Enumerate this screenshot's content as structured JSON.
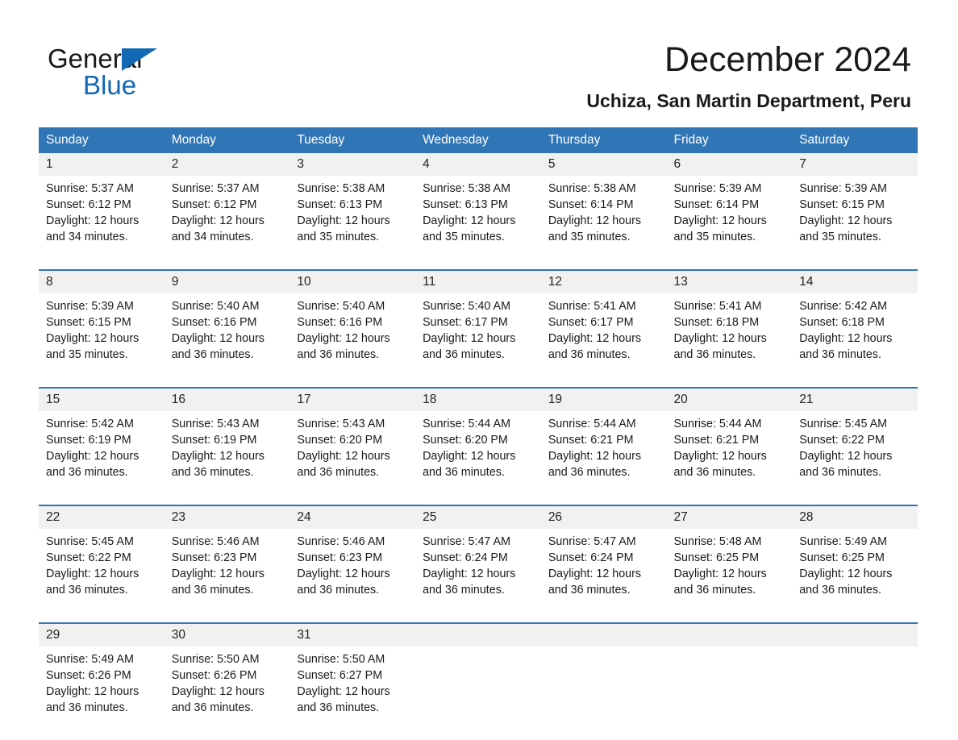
{
  "brand": {
    "name_part1": "General",
    "name_part2": "Blue",
    "logo_icon": "triangle-logo-icon"
  },
  "header": {
    "month_title": "December 2024",
    "location": "Uchiza, San Martin Department, Peru"
  },
  "theme": {
    "header_blue": "#3075b5",
    "daynum_band": "#f1f1f1",
    "logo_blue": "#1268b3",
    "text": "#1a1a1a"
  },
  "calendar": {
    "weekday_headers": [
      "Sunday",
      "Monday",
      "Tuesday",
      "Wednesday",
      "Thursday",
      "Friday",
      "Saturday"
    ],
    "weeks": [
      {
        "days": [
          {
            "date": "1",
            "sunrise": "Sunrise: 5:37 AM",
            "sunset": "Sunset: 6:12 PM",
            "daylight_line1": "Daylight: 12 hours",
            "daylight_line2": "and 34 minutes."
          },
          {
            "date": "2",
            "sunrise": "Sunrise: 5:37 AM",
            "sunset": "Sunset: 6:12 PM",
            "daylight_line1": "Daylight: 12 hours",
            "daylight_line2": "and 34 minutes."
          },
          {
            "date": "3",
            "sunrise": "Sunrise: 5:38 AM",
            "sunset": "Sunset: 6:13 PM",
            "daylight_line1": "Daylight: 12 hours",
            "daylight_line2": "and 35 minutes."
          },
          {
            "date": "4",
            "sunrise": "Sunrise: 5:38 AM",
            "sunset": "Sunset: 6:13 PM",
            "daylight_line1": "Daylight: 12 hours",
            "daylight_line2": "and 35 minutes."
          },
          {
            "date": "5",
            "sunrise": "Sunrise: 5:38 AM",
            "sunset": "Sunset: 6:14 PM",
            "daylight_line1": "Daylight: 12 hours",
            "daylight_line2": "and 35 minutes."
          },
          {
            "date": "6",
            "sunrise": "Sunrise: 5:39 AM",
            "sunset": "Sunset: 6:14 PM",
            "daylight_line1": "Daylight: 12 hours",
            "daylight_line2": "and 35 minutes."
          },
          {
            "date": "7",
            "sunrise": "Sunrise: 5:39 AM",
            "sunset": "Sunset: 6:15 PM",
            "daylight_line1": "Daylight: 12 hours",
            "daylight_line2": "and 35 minutes."
          }
        ]
      },
      {
        "days": [
          {
            "date": "8",
            "sunrise": "Sunrise: 5:39 AM",
            "sunset": "Sunset: 6:15 PM",
            "daylight_line1": "Daylight: 12 hours",
            "daylight_line2": "and 35 minutes."
          },
          {
            "date": "9",
            "sunrise": "Sunrise: 5:40 AM",
            "sunset": "Sunset: 6:16 PM",
            "daylight_line1": "Daylight: 12 hours",
            "daylight_line2": "and 36 minutes."
          },
          {
            "date": "10",
            "sunrise": "Sunrise: 5:40 AM",
            "sunset": "Sunset: 6:16 PM",
            "daylight_line1": "Daylight: 12 hours",
            "daylight_line2": "and 36 minutes."
          },
          {
            "date": "11",
            "sunrise": "Sunrise: 5:40 AM",
            "sunset": "Sunset: 6:17 PM",
            "daylight_line1": "Daylight: 12 hours",
            "daylight_line2": "and 36 minutes."
          },
          {
            "date": "12",
            "sunrise": "Sunrise: 5:41 AM",
            "sunset": "Sunset: 6:17 PM",
            "daylight_line1": "Daylight: 12 hours",
            "daylight_line2": "and 36 minutes."
          },
          {
            "date": "13",
            "sunrise": "Sunrise: 5:41 AM",
            "sunset": "Sunset: 6:18 PM",
            "daylight_line1": "Daylight: 12 hours",
            "daylight_line2": "and 36 minutes."
          },
          {
            "date": "14",
            "sunrise": "Sunrise: 5:42 AM",
            "sunset": "Sunset: 6:18 PM",
            "daylight_line1": "Daylight: 12 hours",
            "daylight_line2": "and 36 minutes."
          }
        ]
      },
      {
        "days": [
          {
            "date": "15",
            "sunrise": "Sunrise: 5:42 AM",
            "sunset": "Sunset: 6:19 PM",
            "daylight_line1": "Daylight: 12 hours",
            "daylight_line2": "and 36 minutes."
          },
          {
            "date": "16",
            "sunrise": "Sunrise: 5:43 AM",
            "sunset": "Sunset: 6:19 PM",
            "daylight_line1": "Daylight: 12 hours",
            "daylight_line2": "and 36 minutes."
          },
          {
            "date": "17",
            "sunrise": "Sunrise: 5:43 AM",
            "sunset": "Sunset: 6:20 PM",
            "daylight_line1": "Daylight: 12 hours",
            "daylight_line2": "and 36 minutes."
          },
          {
            "date": "18",
            "sunrise": "Sunrise: 5:44 AM",
            "sunset": "Sunset: 6:20 PM",
            "daylight_line1": "Daylight: 12 hours",
            "daylight_line2": "and 36 minutes."
          },
          {
            "date": "19",
            "sunrise": "Sunrise: 5:44 AM",
            "sunset": "Sunset: 6:21 PM",
            "daylight_line1": "Daylight: 12 hours",
            "daylight_line2": "and 36 minutes."
          },
          {
            "date": "20",
            "sunrise": "Sunrise: 5:44 AM",
            "sunset": "Sunset: 6:21 PM",
            "daylight_line1": "Daylight: 12 hours",
            "daylight_line2": "and 36 minutes."
          },
          {
            "date": "21",
            "sunrise": "Sunrise: 5:45 AM",
            "sunset": "Sunset: 6:22 PM",
            "daylight_line1": "Daylight: 12 hours",
            "daylight_line2": "and 36 minutes."
          }
        ]
      },
      {
        "days": [
          {
            "date": "22",
            "sunrise": "Sunrise: 5:45 AM",
            "sunset": "Sunset: 6:22 PM",
            "daylight_line1": "Daylight: 12 hours",
            "daylight_line2": "and 36 minutes."
          },
          {
            "date": "23",
            "sunrise": "Sunrise: 5:46 AM",
            "sunset": "Sunset: 6:23 PM",
            "daylight_line1": "Daylight: 12 hours",
            "daylight_line2": "and 36 minutes."
          },
          {
            "date": "24",
            "sunrise": "Sunrise: 5:46 AM",
            "sunset": "Sunset: 6:23 PM",
            "daylight_line1": "Daylight: 12 hours",
            "daylight_line2": "and 36 minutes."
          },
          {
            "date": "25",
            "sunrise": "Sunrise: 5:47 AM",
            "sunset": "Sunset: 6:24 PM",
            "daylight_line1": "Daylight: 12 hours",
            "daylight_line2": "and 36 minutes."
          },
          {
            "date": "26",
            "sunrise": "Sunrise: 5:47 AM",
            "sunset": "Sunset: 6:24 PM",
            "daylight_line1": "Daylight: 12 hours",
            "daylight_line2": "and 36 minutes."
          },
          {
            "date": "27",
            "sunrise": "Sunrise: 5:48 AM",
            "sunset": "Sunset: 6:25 PM",
            "daylight_line1": "Daylight: 12 hours",
            "daylight_line2": "and 36 minutes."
          },
          {
            "date": "28",
            "sunrise": "Sunrise: 5:49 AM",
            "sunset": "Sunset: 6:25 PM",
            "daylight_line1": "Daylight: 12 hours",
            "daylight_line2": "and 36 minutes."
          }
        ]
      },
      {
        "days": [
          {
            "date": "29",
            "sunrise": "Sunrise: 5:49 AM",
            "sunset": "Sunset: 6:26 PM",
            "daylight_line1": "Daylight: 12 hours",
            "daylight_line2": "and 36 minutes."
          },
          {
            "date": "30",
            "sunrise": "Sunrise: 5:50 AM",
            "sunset": "Sunset: 6:26 PM",
            "daylight_line1": "Daylight: 12 hours",
            "daylight_line2": "and 36 minutes."
          },
          {
            "date": "31",
            "sunrise": "Sunrise: 5:50 AM",
            "sunset": "Sunset: 6:27 PM",
            "daylight_line1": "Daylight: 12 hours",
            "daylight_line2": "and 36 minutes."
          },
          {
            "date": "",
            "sunrise": "",
            "sunset": "",
            "daylight_line1": "",
            "daylight_line2": ""
          },
          {
            "date": "",
            "sunrise": "",
            "sunset": "",
            "daylight_line1": "",
            "daylight_line2": ""
          },
          {
            "date": "",
            "sunrise": "",
            "sunset": "",
            "daylight_line1": "",
            "daylight_line2": ""
          },
          {
            "date": "",
            "sunrise": "",
            "sunset": "",
            "daylight_line1": "",
            "daylight_line2": ""
          }
        ]
      }
    ]
  }
}
